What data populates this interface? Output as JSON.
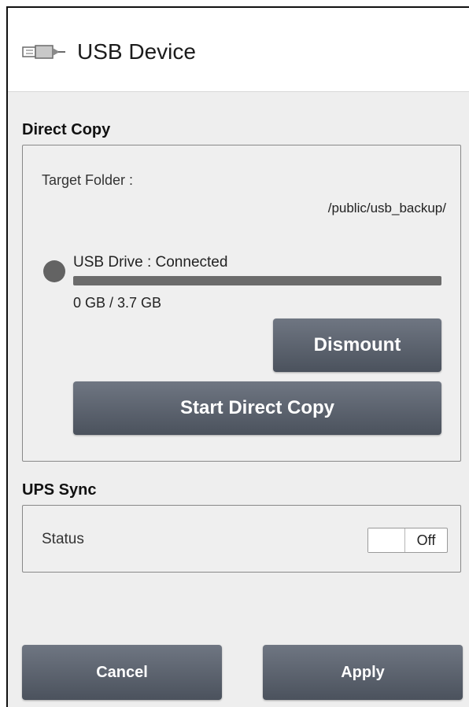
{
  "header": {
    "icon": "usb-plug-icon",
    "title": "USB Device"
  },
  "direct_copy": {
    "section_title": "Direct Copy",
    "target_folder_label": "Target Folder :",
    "target_folder_path": "/public/usb_backup/",
    "drive_status_label": "USB Drive : Connected",
    "usage_fraction": 0.0,
    "capacity_text": "0 GB / 3.7 GB",
    "dismount_label": "Dismount",
    "start_label": "Start Direct Copy"
  },
  "ups_sync": {
    "section_title": "UPS Sync",
    "status_label": "Status",
    "toggle_value": "Off"
  },
  "footer": {
    "cancel_label": "Cancel",
    "apply_label": "Apply"
  },
  "colors": {
    "button": "#565d68",
    "status_dot": "#636363",
    "background": "#eeeeee"
  }
}
